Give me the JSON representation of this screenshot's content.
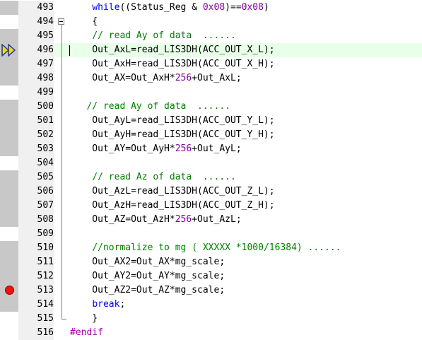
{
  "editor": {
    "current_line": "496",
    "breakpoint_line": "513",
    "lines": [
      {
        "num": "493",
        "marked": true,
        "tokens": [
          {
            "t": "    "
          },
          {
            "t": "while",
            "c": "kw"
          },
          {
            "t": "((Status_Reg & "
          },
          {
            "t": "0x08",
            "c": "num"
          },
          {
            "t": ")=="
          },
          {
            "t": "0x08",
            "c": "num"
          },
          {
            "t": ")"
          }
        ]
      },
      {
        "num": "494",
        "marked": false,
        "tokens": [
          {
            "t": "    {"
          }
        ]
      },
      {
        "num": "495",
        "marked": true,
        "tokens": [
          {
            "t": "    "
          },
          {
            "t": "// read Ay of data  ......",
            "c": "cmt"
          }
        ]
      },
      {
        "num": "496",
        "marked": true,
        "tokens": [
          {
            "t": "    Out_AxL=read_LIS3DH(ACC_OUT_X_L);"
          }
        ]
      },
      {
        "num": "497",
        "marked": true,
        "tokens": [
          {
            "t": "    Out_AxH=read_LIS3DH(ACC_OUT_X_H);"
          }
        ]
      },
      {
        "num": "498",
        "marked": true,
        "tokens": [
          {
            "t": "    Out_AX=Out_AxH*"
          },
          {
            "t": "256",
            "c": "num"
          },
          {
            "t": "+Out_AxL;"
          }
        ]
      },
      {
        "num": "499",
        "marked": false,
        "tokens": [
          {
            "t": ""
          }
        ]
      },
      {
        "num": "500",
        "marked": true,
        "tokens": [
          {
            "t": "   "
          },
          {
            "t": "// read Ay of data  ......",
            "c": "cmt"
          }
        ]
      },
      {
        "num": "501",
        "marked": true,
        "tokens": [
          {
            "t": "    Out_AyL=read_LIS3DH(ACC_OUT_Y_L);"
          }
        ]
      },
      {
        "num": "502",
        "marked": true,
        "tokens": [
          {
            "t": "    Out_AyH=read_LIS3DH(ACC_OUT_Y_H);"
          }
        ]
      },
      {
        "num": "503",
        "marked": true,
        "tokens": [
          {
            "t": "    Out_AY=Out_AyH*"
          },
          {
            "t": "256",
            "c": "num"
          },
          {
            "t": "+Out_AyL;"
          }
        ]
      },
      {
        "num": "504",
        "marked": false,
        "tokens": [
          {
            "t": ""
          }
        ]
      },
      {
        "num": "505",
        "marked": true,
        "tokens": [
          {
            "t": "    "
          },
          {
            "t": "// read Az of data  ......",
            "c": "cmt"
          }
        ]
      },
      {
        "num": "506",
        "marked": true,
        "tokens": [
          {
            "t": "    Out_AzL=read_LIS3DH(ACC_OUT_Z_L);"
          }
        ]
      },
      {
        "num": "507",
        "marked": true,
        "tokens": [
          {
            "t": "    Out_AzH=read_LIS3DH(ACC_OUT_Z_H);"
          }
        ]
      },
      {
        "num": "508",
        "marked": true,
        "tokens": [
          {
            "t": "    Out_AZ=Out_AzH*"
          },
          {
            "t": "256",
            "c": "num"
          },
          {
            "t": "+Out_AzL;"
          }
        ]
      },
      {
        "num": "509",
        "marked": false,
        "tokens": [
          {
            "t": ""
          }
        ]
      },
      {
        "num": "510",
        "marked": true,
        "tokens": [
          {
            "t": "    "
          },
          {
            "t": "//normalize to mg ( XXXXX *1000/16384) ......",
            "c": "cmt"
          }
        ]
      },
      {
        "num": "511",
        "marked": true,
        "tokens": [
          {
            "t": "    Out_AX2=Out_AX*mg_scale;"
          }
        ]
      },
      {
        "num": "512",
        "marked": true,
        "tokens": [
          {
            "t": "    Out_AY2=Out_AY*mg_scale;"
          }
        ]
      },
      {
        "num": "513",
        "marked": true,
        "tokens": [
          {
            "t": "    Out_AZ2=Out_AZ*mg_scale;"
          }
        ]
      },
      {
        "num": "514",
        "marked": true,
        "tokens": [
          {
            "t": "    "
          },
          {
            "t": "break",
            "c": "kw"
          },
          {
            "t": ";"
          }
        ]
      },
      {
        "num": "515",
        "marked": false,
        "tokens": [
          {
            "t": "    }"
          }
        ]
      },
      {
        "num": "516",
        "marked": false,
        "tokens": [
          {
            "t": "#endif",
            "c": "pp"
          }
        ]
      }
    ]
  },
  "icons": {
    "breakpoint": "breakpoint-icon",
    "execution_arrow": "execution-arrow-icon",
    "fold_collapse": "fold-collapse-icon"
  },
  "colors": {
    "keyword": "#0000ff",
    "number": "#8000a0",
    "comment": "#008000",
    "preprocessor": "#a000a0",
    "current_line_bg": "#e8ffe8",
    "breakpoint": "#ee1111",
    "execution_arrow": "#f5d800"
  }
}
